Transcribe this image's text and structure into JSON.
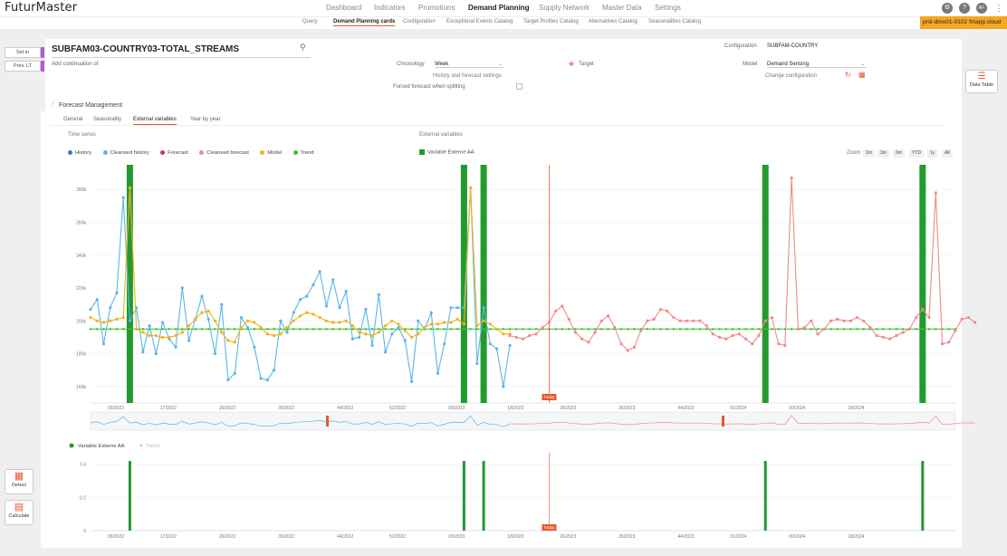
{
  "app": {
    "logo": "FuturMaster"
  },
  "nav": {
    "items": [
      "Dashboard",
      "Indicators",
      "Promotions",
      "Demand Planning",
      "Supply Network",
      "Master Data",
      "Settings"
    ],
    "active": "Demand Planning"
  },
  "user": {
    "initials": "AF"
  },
  "subnav": {
    "items": [
      "Query",
      "Demand Planning cards",
      "Configuration",
      "Exceptional Events Catalog",
      "Target Profiles Catalog",
      "Alternatives Catalog",
      "Seasonalities Catalog"
    ],
    "active": "Demand Planning cards"
  },
  "instance": {
    "label": "prsl-dmo01-0102 fmapp.cloud"
  },
  "left": {
    "set_in": "Set in",
    "prev_lt": "Prév. LT",
    "detect": "Detect",
    "calculate": "Calculate"
  },
  "header": {
    "title": "SUBFAM03-COUNTRY03-TOTAL_STREAMS",
    "add_continuation": "Add continuation of",
    "chronology_label": "Chronology",
    "chronology_value": "Week",
    "history_settings": "History and forecast settings",
    "forced_forecast": "Forced forecast when splitting",
    "target": "Target",
    "configuration_label": "Configuration",
    "configuration_value": "SUBFAM-COUNTRY",
    "model_label": "Model",
    "model_value": "Demand Sensing",
    "change_configuration": "Change configuration"
  },
  "right": {
    "data_table": "Data Table"
  },
  "section": {
    "title": "Forecast Management"
  },
  "tabs": [
    "General",
    "Seasonality",
    "External variables",
    "Year by year"
  ],
  "tabs_active": "External variables",
  "chart_labels": {
    "time_series": "Time series",
    "external_variables": "External variables",
    "zoom": "Zoom",
    "today": "Today"
  },
  "zoom_options": [
    "1m",
    "3m",
    "6m",
    "YTD",
    "1y",
    "All"
  ],
  "colors": {
    "history": "#2f7ad6",
    "cleansed_history": "#5bb6e6",
    "forecast": "#c2414b",
    "cleansed_forecast": "#f08a8a",
    "model": "#f2b21a",
    "trend": "#3fbf2f",
    "ext_var": "#229a2f",
    "accent": "#e8572a"
  },
  "chart_data": [
    {
      "type": "line",
      "legend": [
        "History",
        "Cleansed history",
        "Forecast",
        "Cleansed forecast",
        "Model",
        "Trend"
      ],
      "ext_legend": [
        "Variable Externe AA"
      ],
      "x_ticks": [
        "09/2022",
        "17/2022",
        "26/2022",
        "35/2022",
        "44/2022",
        "52/2022",
        "09/2023",
        "18/2023",
        "26/2023",
        "35/2023",
        "44/2023",
        "01/2024",
        "09/2024",
        "18/2024"
      ],
      "y_ticks": [
        "160k",
        "180k",
        "200k",
        "220k",
        "240k",
        "260k",
        "280k"
      ],
      "ylim": [
        150,
        295
      ],
      "x_range": [
        0,
        132
      ],
      "today_index": 70,
      "ext_weeks": [
        6,
        57,
        60,
        103,
        127
      ],
      "cleansed_history": [
        207,
        213,
        186,
        208,
        217,
        275,
        200,
        208,
        181,
        197,
        180,
        199,
        189,
        184,
        220,
        188,
        201,
        215,
        201,
        180,
        210,
        164,
        168,
        202,
        196,
        184,
        165,
        164,
        170,
        200,
        193,
        205,
        213,
        215,
        222,
        230,
        209,
        225,
        208,
        218,
        189,
        190,
        207,
        185,
        216,
        181,
        192,
        196,
        188,
        163,
        200,
        195,
        205,
        168,
        186,
        208,
        208,
        208,
        281,
        174,
        208,
        186,
        183,
        160,
        185
      ],
      "model": [
        202,
        200,
        199,
        200,
        201,
        202,
        281,
        195,
        193,
        191,
        191,
        190,
        190,
        191,
        193,
        197,
        201,
        205,
        206,
        200,
        193,
        188,
        187,
        196,
        200,
        199,
        196,
        192,
        191,
        192,
        196,
        200,
        203,
        205,
        204,
        202,
        200,
        199,
        199,
        200,
        197,
        193,
        192,
        191,
        193,
        197,
        200,
        198,
        194,
        190,
        192,
        196,
        198,
        198,
        199,
        199,
        201,
        198,
        281,
        197,
        200,
        198,
        195,
        192,
        192
      ],
      "cleansed_forecast": [
        191,
        190,
        189,
        191,
        192,
        196,
        199,
        206,
        209,
        201,
        193,
        189,
        187,
        193,
        200,
        203,
        196,
        186,
        182,
        184,
        194,
        200,
        201,
        207,
        206,
        202,
        200,
        200,
        200,
        200,
        197,
        192,
        190,
        189,
        191,
        192,
        189,
        186,
        191,
        200,
        202,
        186,
        185,
        287,
        195,
        196,
        200,
        192,
        195,
        200,
        201,
        200,
        200,
        202,
        200,
        196,
        191,
        190,
        189,
        191,
        193,
        195,
        202,
        207,
        202,
        278,
        186,
        187,
        194,
        201,
        202,
        199
      ],
      "trend": 195
    },
    {
      "type": "bar",
      "series": [
        {
          "name": "Variable Externe AA",
          "values": [
            0.42,
            0.42,
            0.42,
            0.42,
            0.42
          ],
          "weeks": [
            6,
            57,
            60,
            103,
            127
          ]
        }
      ],
      "y_ticks": [
        "0",
        "0.2",
        "0.4"
      ],
      "ylim": [
        0,
        0.42
      ],
      "legend": [
        "Variable Externe AA",
        "Trend"
      ],
      "x_ticks": [
        "09/2022",
        "17/2022",
        "26/2022",
        "35/2022",
        "44/2022",
        "52/2022",
        "09/2023",
        "18/2023",
        "26/2023",
        "35/2023",
        "44/2023",
        "01/2024",
        "09/2024",
        "18/2024"
      ]
    }
  ]
}
